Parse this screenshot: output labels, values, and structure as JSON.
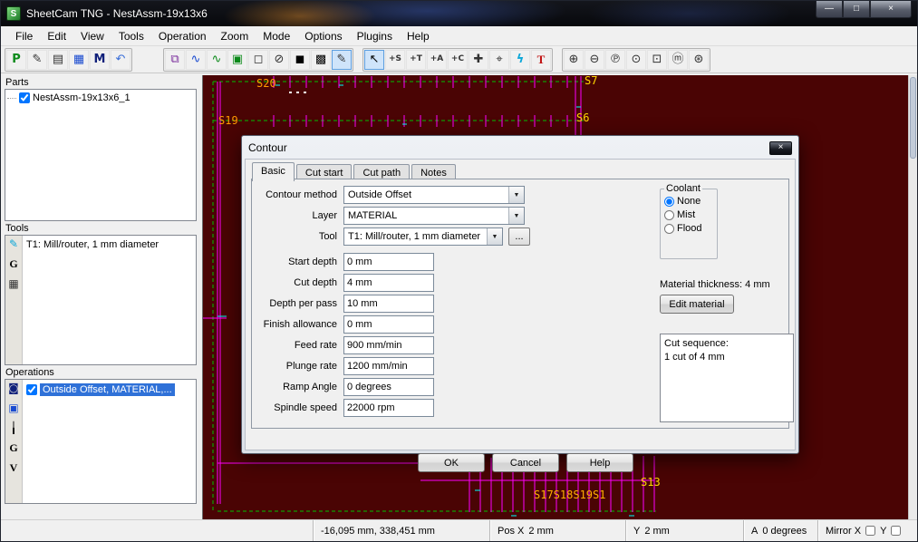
{
  "window": {
    "title": "SheetCam TNG - NestAssm-19x13x6",
    "icon_letter": "S",
    "controls": {
      "minimize": "—",
      "maximize": "□",
      "close": "×"
    }
  },
  "menu": {
    "items": [
      "File",
      "Edit",
      "View",
      "Tools",
      "Operation",
      "Zoom",
      "Mode",
      "Options",
      "Plugins",
      "Help"
    ]
  },
  "toolbar": {
    "g1": [
      {
        "name": "run-post-processor-icon",
        "glyph": "P"
      },
      {
        "name": "edit-part-icon",
        "glyph": "✎"
      },
      {
        "name": "print-icon",
        "glyph": "▤"
      },
      {
        "name": "simulate-icon",
        "glyph": "▦"
      },
      {
        "name": "machine-icon",
        "glyph": "M"
      },
      {
        "name": "undo-icon",
        "glyph": "↶"
      }
    ],
    "g2": [
      {
        "name": "show-parts-icon",
        "glyph": "⧉"
      },
      {
        "name": "show-toolpath-icon",
        "glyph": "∿"
      },
      {
        "name": "show-rapids-icon",
        "glyph": "∿"
      },
      {
        "name": "show-material-icon",
        "glyph": "▣"
      },
      {
        "name": "show-machine-extents-icon",
        "glyph": "◻"
      },
      {
        "name": "show-tool-icon",
        "glyph": "⊘"
      },
      {
        "name": "black-background-icon",
        "glyph": "◼"
      },
      {
        "name": "show-cut-direction-icon",
        "glyph": "▩"
      },
      {
        "name": "edit-drawing-icon",
        "glyph": "✎"
      }
    ],
    "g3": [
      {
        "name": "select-cursor-icon",
        "glyph": "↖"
      },
      {
        "name": "select-start-point-icon",
        "glyph": "+S"
      },
      {
        "name": "select-tab-icon",
        "glyph": "+T"
      },
      {
        "name": "select-arc-icon",
        "glyph": "+A"
      },
      {
        "name": "select-contour-icon",
        "glyph": "+C"
      },
      {
        "name": "move-part-icon",
        "glyph": "✚"
      },
      {
        "name": "set-origin-icon",
        "glyph": "⌖"
      },
      {
        "name": "measure-icon",
        "glyph": "ϟ"
      },
      {
        "name": "text-tool-icon",
        "glyph": "T"
      }
    ],
    "g4": [
      {
        "name": "zoom-in-icon",
        "glyph": "⊕"
      },
      {
        "name": "zoom-out-icon",
        "glyph": "⊖"
      },
      {
        "name": "zoom-part-icon",
        "glyph": "℗"
      },
      {
        "name": "zoom-extents-icon",
        "glyph": "⊙"
      },
      {
        "name": "zoom-window-icon",
        "glyph": "⊡"
      },
      {
        "name": "zoom-machine-icon",
        "glyph": "ⓜ"
      },
      {
        "name": "zoom-previous-icon",
        "glyph": "⊛"
      }
    ]
  },
  "sidebar": {
    "parts": {
      "title": "Parts",
      "item_label": "NestAssm-19x13x6_1"
    },
    "tools": {
      "title": "Tools",
      "item_label": "T1: Mill/router, 1 mm diameter",
      "strip": [
        {
          "name": "tool-edit-icon",
          "glyph": "✎"
        },
        {
          "name": "tool-gcode-icon",
          "glyph": "G"
        },
        {
          "name": "tool-table-icon",
          "glyph": "▦"
        }
      ]
    },
    "operations": {
      "title": "Operations",
      "item_label": "Outside Offset, MATERIAL,...",
      "strip": [
        {
          "name": "op-insert-icon",
          "glyph": "◙"
        },
        {
          "name": "op-outline-icon",
          "glyph": "▣"
        },
        {
          "name": "op-drill-icon",
          "glyph": "╽"
        },
        {
          "name": "op-gcode-icon",
          "glyph": "G"
        },
        {
          "name": "op-vcarve-icon",
          "glyph": "V"
        }
      ]
    }
  },
  "canvas": {
    "labels": [
      {
        "text": "S20"
      },
      {
        "text": "S19"
      },
      {
        "text": "S7"
      },
      {
        "text": "S6"
      },
      {
        "text": "S13"
      },
      {
        "text": "S17S18S19S1"
      }
    ]
  },
  "dialog": {
    "title": "Contour",
    "close_glyph": "×",
    "tabs": [
      {
        "label": "Basic"
      },
      {
        "label": "Cut start"
      },
      {
        "label": "Cut path"
      },
      {
        "label": "Notes"
      }
    ],
    "fields": [
      {
        "label": "Contour method",
        "value": "Outside Offset"
      },
      {
        "label": "Layer",
        "value": "MATERIAL"
      },
      {
        "label": "Tool",
        "value": "T1: Mill/router, 1 mm diameter",
        "browse": "..."
      },
      {
        "label": "Start depth",
        "value": "0 mm"
      },
      {
        "label": "Cut depth",
        "value": "4 mm"
      },
      {
        "label": "Depth per pass",
        "value": "10 mm"
      },
      {
        "label": "Finish allowance",
        "value": "0 mm"
      },
      {
        "label": "Feed rate",
        "value": "900 mm/min"
      },
      {
        "label": "Plunge rate",
        "value": "1200 mm/min"
      },
      {
        "label": "Ramp Angle",
        "value": "0 degrees"
      },
      {
        "label": "Spindle speed",
        "value": "22000 rpm"
      }
    ],
    "coolant": {
      "legend": "Coolant",
      "options": [
        {
          "label": "None"
        },
        {
          "label": "Mist"
        },
        {
          "label": "Flood"
        }
      ],
      "selected": "None"
    },
    "material_thickness": "Material thickness: 4 mm",
    "edit_material_label": "Edit material",
    "cut_sequence": [
      "Cut sequence:",
      "1 cut of 4 mm"
    ],
    "buttons": {
      "ok": "OK",
      "cancel": "Cancel",
      "help": "Help"
    }
  },
  "statusbar": {
    "coords": "-16,095 mm, 338,451 mm",
    "pos_x_label": "Pos X",
    "pos_x_value": "2 mm",
    "y_label": "Y",
    "y_value": "2 mm",
    "a_label": "A",
    "a_value": "0 degrees",
    "mirror_label": "Mirror X",
    "mirror_y_label": "Y"
  },
  "ui": {
    "dropdown_arrow": "▼"
  },
  "colors": {
    "canvas_bg": "#4a0404",
    "part_outline": "#ff00ff",
    "sheet_line": "#00c000",
    "snap_marks": "#00ffff",
    "label_yellow": "#ffd800",
    "label_orange": "#ff9a00",
    "selection_blue": "#2f71d8"
  }
}
